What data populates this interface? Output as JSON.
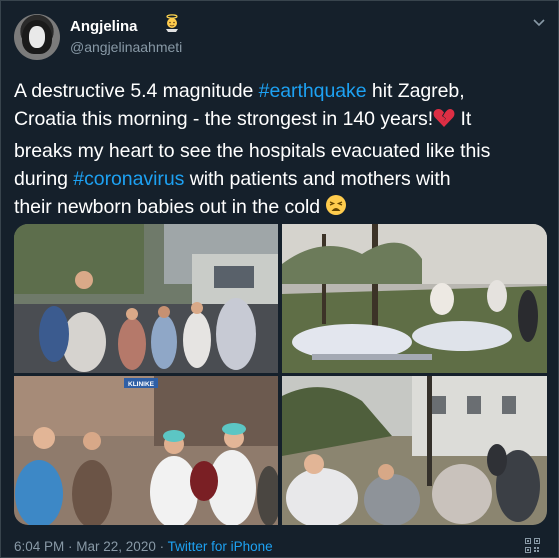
{
  "user": {
    "name": "Angjelina",
    "handle": "@angjelinaahmeti"
  },
  "tweet": {
    "lines": [
      [
        {
          "text": "A destructive 5.4 magnitude ",
          "link": false
        },
        {
          "text": "#earthquake",
          "link": true
        },
        {
          "text": " hit Zagreb,",
          "link": false
        }
      ],
      [
        {
          "text": "Croatia this morning - the strongest in 140 years!",
          "link": false
        },
        {
          "emoji": "broken-heart"
        },
        {
          "text": " It",
          "link": false
        }
      ],
      [
        {
          "text": "breaks my heart to see the hospitals evacuated like this",
          "link": false
        }
      ],
      [
        {
          "text": "during ",
          "link": false
        },
        {
          "text": "#coronavirus",
          "link": true
        },
        {
          "text": " with patients and mothers with",
          "link": false
        }
      ],
      [
        {
          "text": "their newborn babies out in the cold ",
          "link": false
        },
        {
          "emoji": "weary-face"
        }
      ]
    ],
    "hashtags": [
      "#earthquake",
      "#coronavirus"
    ]
  },
  "media": {
    "photos": [
      {
        "name": "photo-mothers-newborns",
        "sign_text": ""
      },
      {
        "name": "photo-hospital-beds-outside",
        "sign_text": ""
      },
      {
        "name": "photo-medical-staff",
        "sign_text": "KLINIKE"
      },
      {
        "name": "photo-patients-blankets",
        "sign_text": ""
      }
    ]
  },
  "footer": {
    "time": "6:04 PM",
    "separator": " · ",
    "date": "Mar 22, 2020",
    "client": "Twitter for iPhone"
  },
  "colors": {
    "background": "#15202b",
    "link": "#1da1f2",
    "secondary_text": "#8899a6",
    "border": "#38444d"
  }
}
